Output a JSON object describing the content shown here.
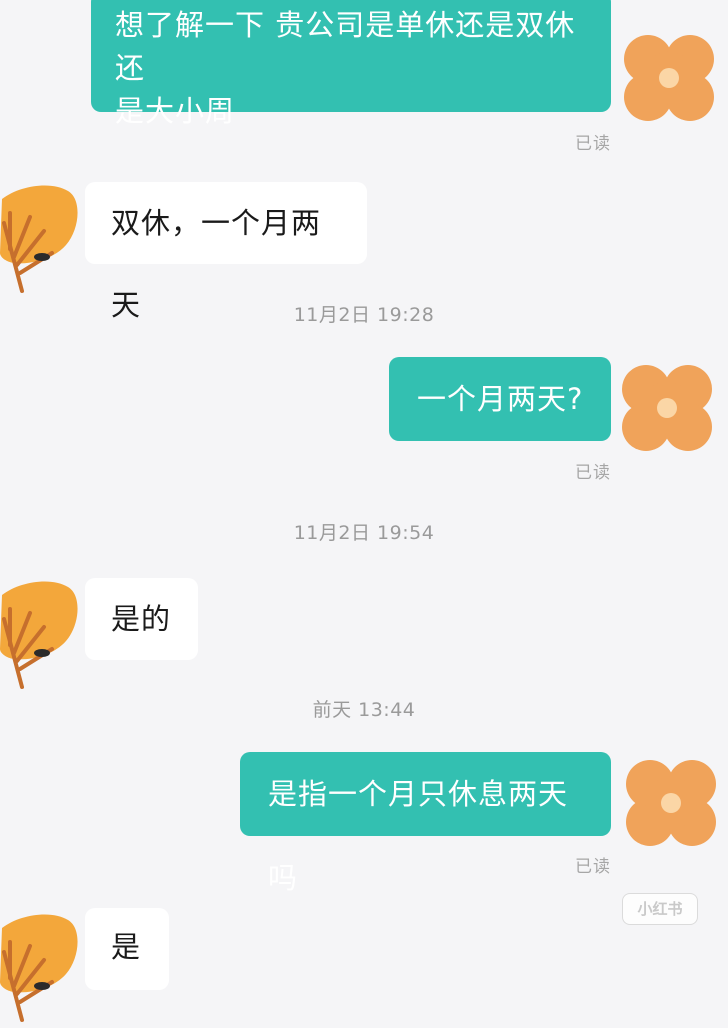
{
  "messages": [
    {
      "side": "out",
      "text": "想了解一下 贵公司是单休还是双休还是大小周",
      "line1": "想了解一下 贵公司是单休还是双休还",
      "line2": "是大小周",
      "status": "已读"
    },
    {
      "side": "in",
      "text": "双休，一个月两天"
    },
    {
      "type": "time",
      "text": "11月2日 19:28"
    },
    {
      "side": "out",
      "text": "一个月两天?",
      "status": "已读"
    },
    {
      "type": "time",
      "text": "11月2日 19:54"
    },
    {
      "side": "in",
      "text": "是的"
    },
    {
      "type": "time",
      "text": "前天 13:44"
    },
    {
      "side": "out",
      "text": "是指一个月只休息两天吗",
      "status": "已读"
    },
    {
      "side": "in",
      "text": "是"
    }
  ],
  "watermark": "小红书",
  "colors": {
    "background": "#f5f5f7",
    "outgoing_bubble": "#33c0b1",
    "incoming_bubble": "#ffffff",
    "flower_avatar": "#f0a35a",
    "leaf_avatar": "#f3a73b"
  },
  "icons": {
    "self_avatar": "orange-flower-avatar",
    "contact_avatar": "orange-leaf-avatar"
  }
}
